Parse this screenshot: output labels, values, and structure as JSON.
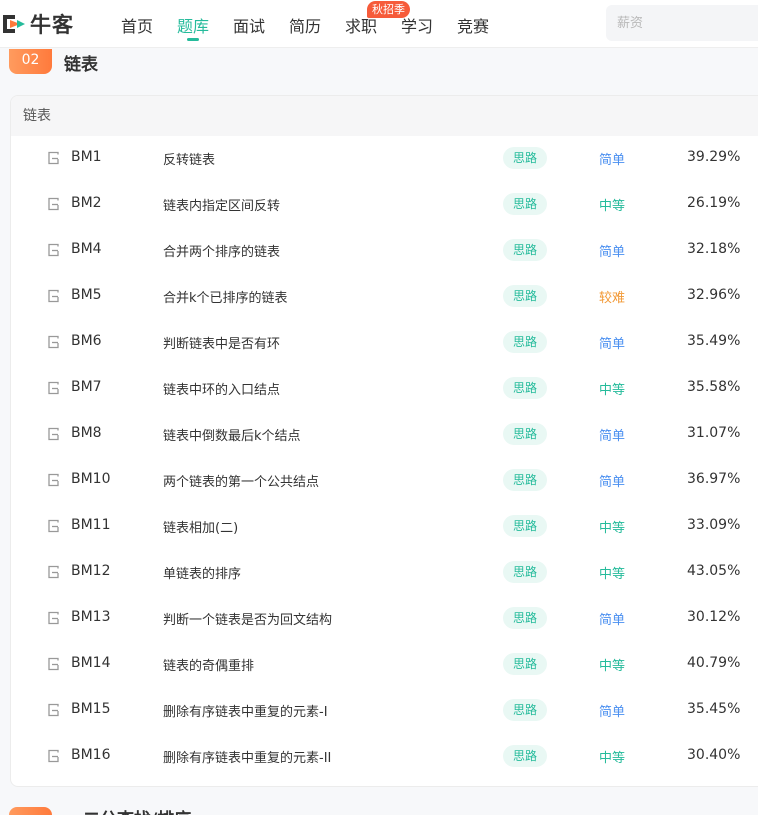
{
  "brand": {
    "logo_text": "牛客"
  },
  "nav": {
    "items": [
      {
        "label": "首页"
      },
      {
        "label": "题库"
      },
      {
        "label": "面试"
      },
      {
        "label": "简历"
      },
      {
        "label": "求职",
        "badge": "秋招季"
      },
      {
        "label": "学习"
      },
      {
        "label": "竞赛"
      }
    ],
    "active": "题库",
    "search_placeholder": "薪资"
  },
  "section": {
    "number": "02",
    "title": "链表"
  },
  "card": {
    "header": "链表",
    "rows": [
      {
        "code": "BM1",
        "title": "反转链表",
        "hint": "思路",
        "difficulty": "简单",
        "level": "easy",
        "rate": "39.29%"
      },
      {
        "code": "BM2",
        "title": "链表内指定区间反转",
        "hint": "思路",
        "difficulty": "中等",
        "level": "medium",
        "rate": "26.19%"
      },
      {
        "code": "BM4",
        "title": "合并两个排序的链表",
        "hint": "思路",
        "difficulty": "简单",
        "level": "easy",
        "rate": "32.18%"
      },
      {
        "code": "BM5",
        "title": "合并k个已排序的链表",
        "hint": "思路",
        "difficulty": "较难",
        "level": "hard",
        "rate": "32.96%"
      },
      {
        "code": "BM6",
        "title": "判断链表中是否有环",
        "hint": "思路",
        "difficulty": "简单",
        "level": "easy",
        "rate": "35.49%"
      },
      {
        "code": "BM7",
        "title": "链表中环的入口结点",
        "hint": "思路",
        "difficulty": "中等",
        "level": "medium",
        "rate": "35.58%"
      },
      {
        "code": "BM8",
        "title": "链表中倒数最后k个结点",
        "hint": "思路",
        "difficulty": "简单",
        "level": "easy",
        "rate": "31.07%"
      },
      {
        "code": "BM10",
        "title": "两个链表的第一个公共结点",
        "hint": "思路",
        "difficulty": "简单",
        "level": "easy",
        "rate": "36.97%"
      },
      {
        "code": "BM11",
        "title": "链表相加(二)",
        "hint": "思路",
        "difficulty": "中等",
        "level": "medium",
        "rate": "33.09%"
      },
      {
        "code": "BM12",
        "title": "单链表的排序",
        "hint": "思路",
        "difficulty": "中等",
        "level": "medium",
        "rate": "43.05%"
      },
      {
        "code": "BM13",
        "title": "判断一个链表是否为回文结构",
        "hint": "思路",
        "difficulty": "简单",
        "level": "easy",
        "rate": "30.12%"
      },
      {
        "code": "BM14",
        "title": "链表的奇偶重排",
        "hint": "思路",
        "difficulty": "中等",
        "level": "medium",
        "rate": "40.79%"
      },
      {
        "code": "BM15",
        "title": "删除有序链表中重复的元素-I",
        "hint": "思路",
        "difficulty": "简单",
        "level": "easy",
        "rate": "35.45%"
      },
      {
        "code": "BM16",
        "title": "删除有序链表中重复的元素-II",
        "hint": "思路",
        "difficulty": "中等",
        "level": "medium",
        "rate": "30.40%"
      }
    ]
  },
  "next_section": {
    "title": "二分查找/排序"
  },
  "colors": {
    "accent": "#25bb9b",
    "easy": "#4a8ff0",
    "medium": "#25bb9b",
    "hard": "#f29834",
    "badge": "#f65b3a",
    "section_badge": "#ff8a4a"
  }
}
